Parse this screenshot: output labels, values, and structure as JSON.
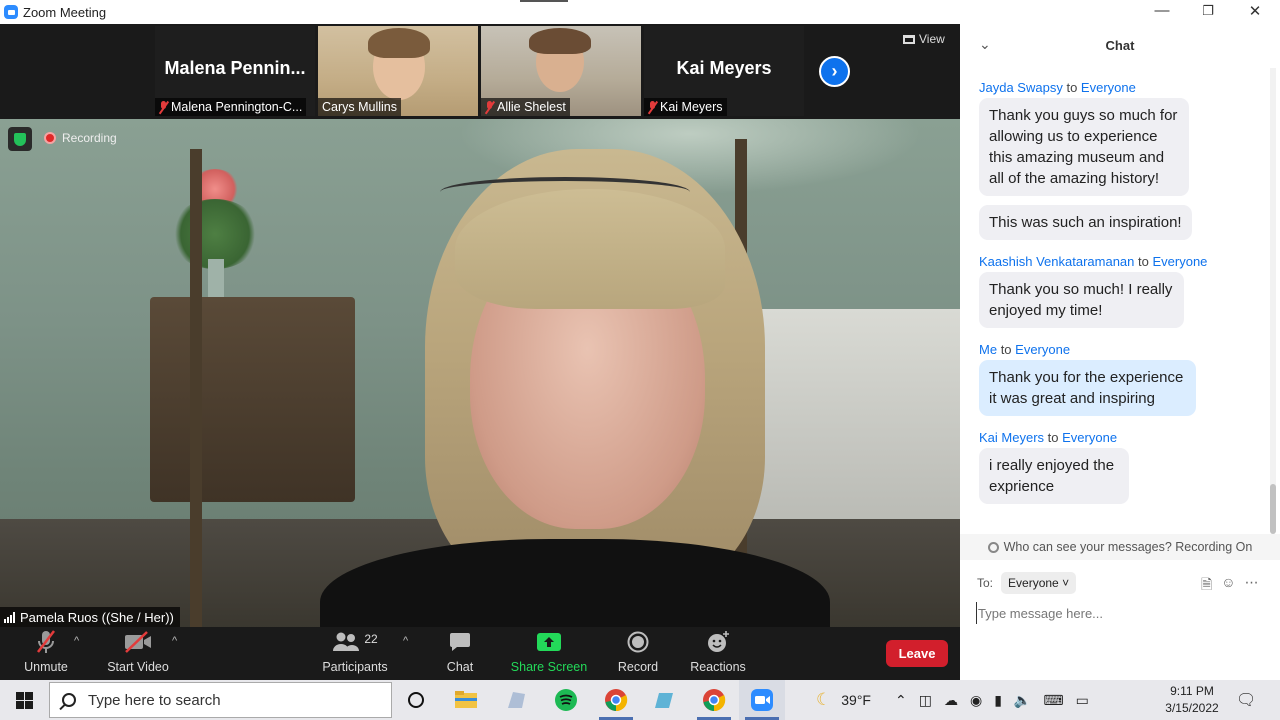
{
  "window": {
    "title": "Zoom Meeting",
    "controls": [
      "minimize-icon",
      "restore-icon",
      "close-icon"
    ]
  },
  "gallery": {
    "view_label": "View",
    "tiles": [
      {
        "big_name": "Malena  Pennin...",
        "name": "Malena Pennington-C...",
        "muted": true,
        "video": false
      },
      {
        "name": "Carys Mullins",
        "muted": false,
        "video": true
      },
      {
        "name": "Allie Shelest",
        "muted": true,
        "video": true
      },
      {
        "big_name": "Kai Meyers",
        "name": "Kai Meyers",
        "muted": true,
        "video": false
      }
    ],
    "next_icon": "chevron-right-icon"
  },
  "main_video": {
    "recording_label": "Recording",
    "speaker_name": "Pamela Ruos ((She / Her))"
  },
  "toolbar": {
    "unmute": "Unmute",
    "start_video": "Start Video",
    "participants": "Participants",
    "participants_count": "22",
    "chat": "Chat",
    "share_screen": "Share Screen",
    "record": "Record",
    "reactions": "Reactions",
    "leave": "Leave",
    "colors": {
      "share": "#23d959",
      "leave": "#d21f2c"
    }
  },
  "chat": {
    "title": "Chat",
    "messages": [
      {
        "from": "Jayda Swapsy",
        "to_word": "to",
        "to": "Everyone",
        "bubbles": [
          "Thank you guys so much for allowing us to experience this amazing museum and all of the amazing history!",
          "This was such an inspiration!"
        ]
      },
      {
        "from": "Kaashish Venkataramanan",
        "to_word": "to",
        "to": "Everyone",
        "bubbles": [
          "Thank you so much! I really enjoyed my time!"
        ]
      },
      {
        "from": "Me",
        "to_word": "to",
        "to": "Everyone",
        "bubbles": [
          "Thank you for the experience it was great and inspiring"
        ]
      },
      {
        "from": "Kai Meyers",
        "to_word": "to",
        "to": "Everyone",
        "bubbles": [
          "i really enjoyed the exprience"
        ]
      }
    ],
    "privacy_note": "Who can see your messages? Recording On",
    "to_label": "To:",
    "to_value": "Everyone",
    "input_placeholder": "Type message here..."
  },
  "taskbar": {
    "search_placeholder": "Type here to search",
    "weather": "39°F",
    "time": "9:11 PM",
    "date": "3/15/2022"
  }
}
